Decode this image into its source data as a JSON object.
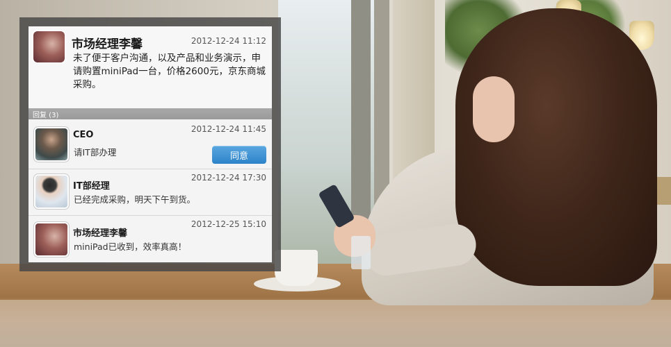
{
  "post": {
    "author": "市场经理李馨",
    "time": "2012-12-24  11:12",
    "body": "未了便于客户沟通，以及产品和业务演示，申请购置miniPad一台，价格2600元，京东商城采购。",
    "avatar_icon": "user-avatar"
  },
  "replies_header": "回复 (3)",
  "replies": [
    {
      "author": "CEO",
      "time": "2012-12-24  11:45",
      "text": "请IT部办理",
      "avatar_icon": "user-avatar",
      "action_label": "同意"
    },
    {
      "author": "IT部经理",
      "time": "2012-12-24  17:30",
      "text": "已经完成采购，明天下午到货。",
      "avatar_icon": "user-avatar"
    },
    {
      "author": "市场经理李馨",
      "time": "2012-12-25  15:10",
      "text": "miniPad已收到，效率真高！",
      "avatar_icon": "user-avatar"
    }
  ],
  "colors": {
    "accent": "#2d83c9",
    "panel_frame": "#464646",
    "reply_bar": "#9a9a9a"
  }
}
